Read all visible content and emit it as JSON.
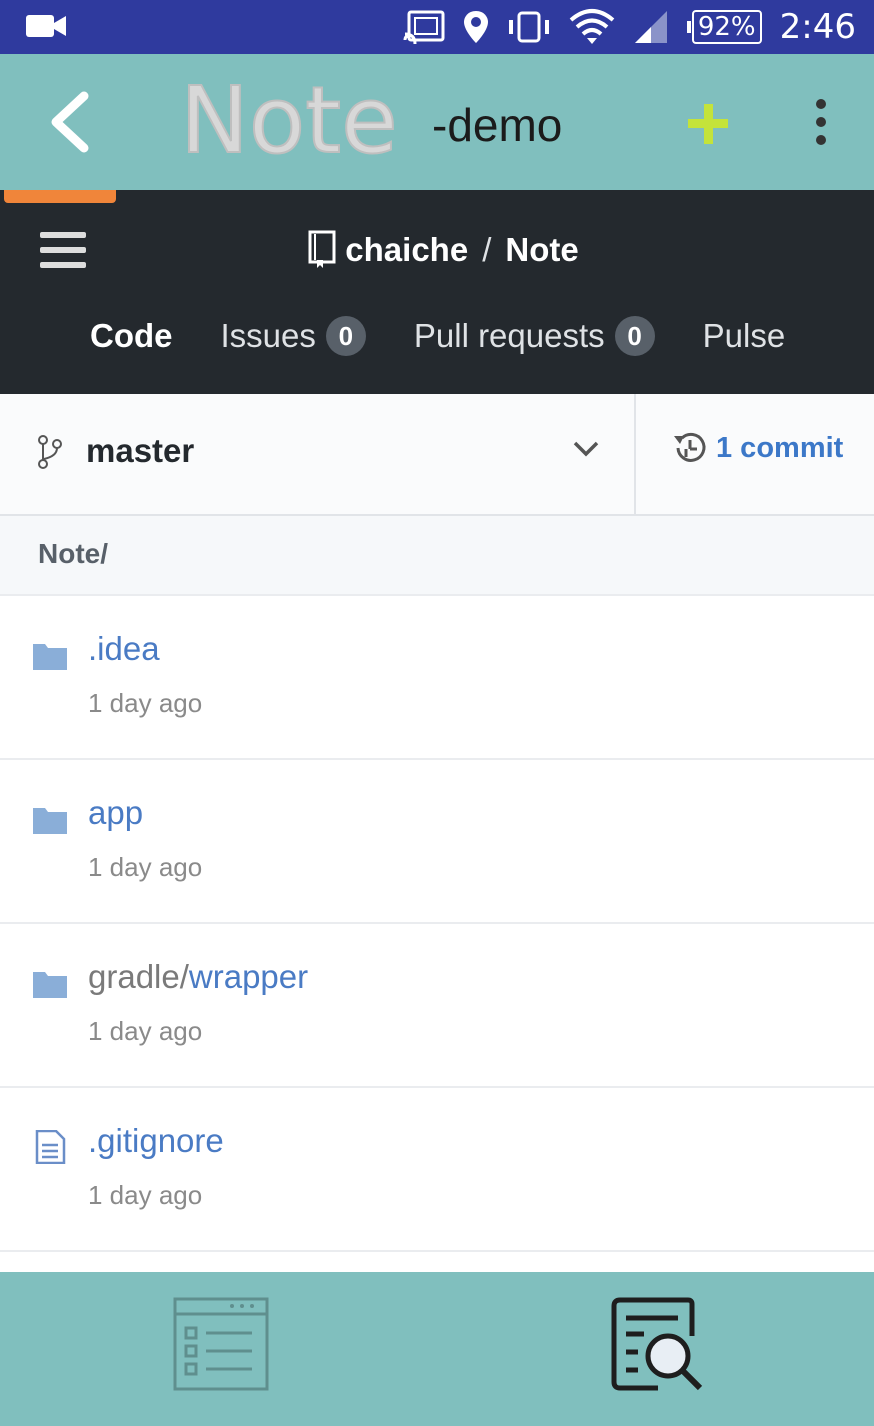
{
  "status_bar": {
    "battery": "92%",
    "time": "2:46"
  },
  "app_bar": {
    "logo_text": "Note",
    "title_suffix": "-demo",
    "add_color": "#c4e33a"
  },
  "github": {
    "owner": "chaiche",
    "separator": "/",
    "repo": "Note",
    "tabs": [
      {
        "label": "Code"
      },
      {
        "label": "Issues",
        "count": "0"
      },
      {
        "label": "Pull requests",
        "count": "0"
      },
      {
        "label": "Pulse"
      }
    ],
    "branch": "master",
    "commits": "1 commit",
    "path": "Note/",
    "files": [
      {
        "prefix": "",
        "name": ".idea",
        "time": "1 day ago",
        "type": "folder"
      },
      {
        "prefix": "",
        "name": "app",
        "time": "1 day ago",
        "type": "folder"
      },
      {
        "prefix": "gradle/",
        "name": "wrapper",
        "time": "1 day ago",
        "type": "folder"
      },
      {
        "prefix": "",
        "name": ".gitignore",
        "time": "1 day ago",
        "type": "file"
      }
    ]
  },
  "colors": {
    "status_bar": "#2f3a9e",
    "toolbar": "#80bfbe",
    "github_header": "#24292e",
    "link": "#4a7bc4",
    "progress": "#f0853a"
  },
  "icons": {
    "status": [
      "video-camera-icon",
      "cast-icon",
      "location-icon",
      "vibrate-icon",
      "wifi-icon",
      "signal-icon"
    ],
    "bottom": [
      "list-view-icon",
      "search-document-icon"
    ]
  }
}
